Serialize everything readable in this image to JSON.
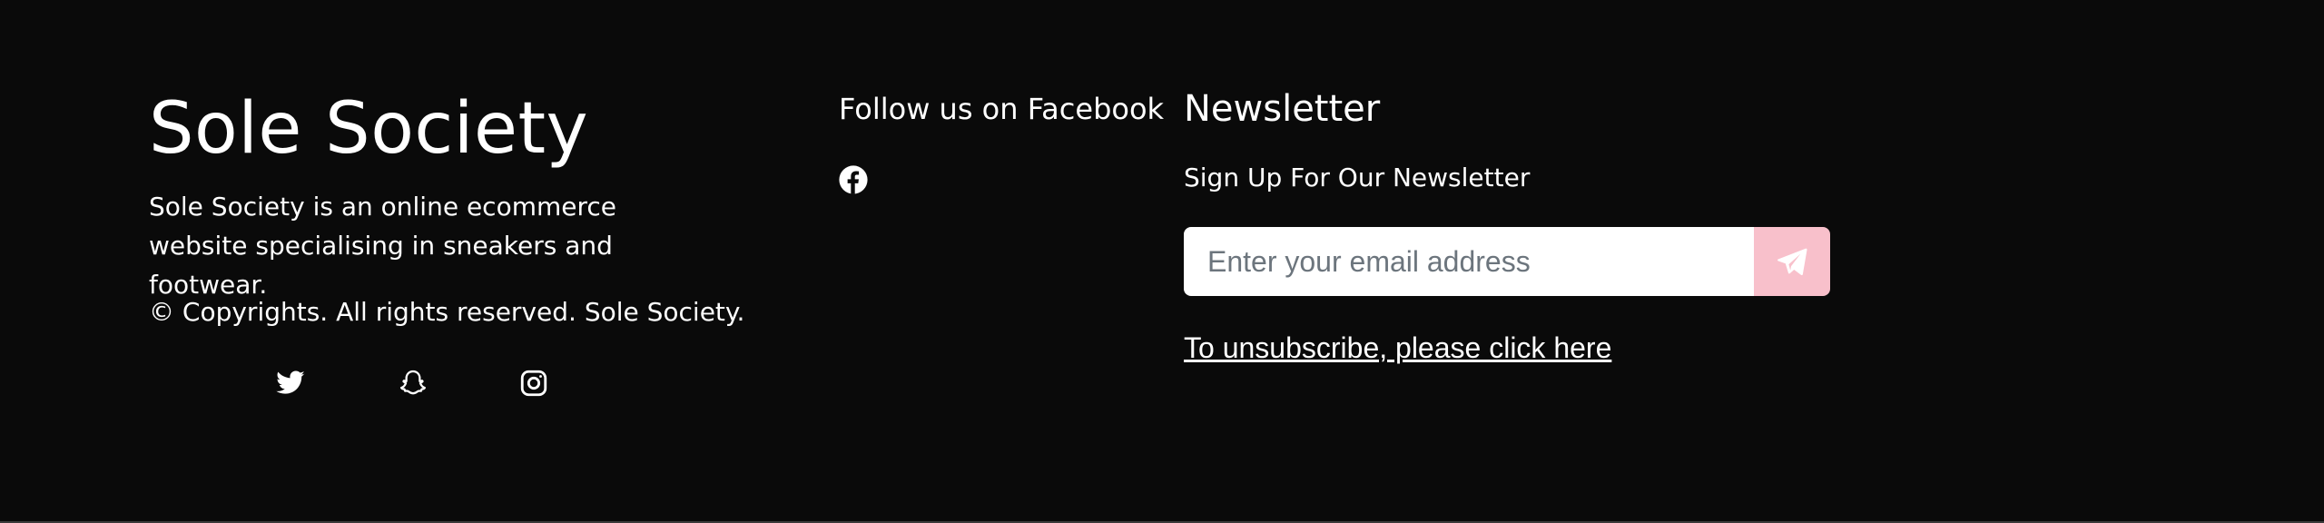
{
  "brand": {
    "title": "Sole Society",
    "description": "Sole Society is an online ecommerce website specialising in sneakers and footwear.",
    "copyright": "© Copyrights. All rights reserved. Sole Society."
  },
  "socials": [
    {
      "name": "twitter",
      "icon": "twitter-icon"
    },
    {
      "name": "snapchat",
      "icon": "snapchat-icon"
    },
    {
      "name": "instagram",
      "icon": "instagram-icon"
    }
  ],
  "facebook": {
    "heading": "Follow us on Facebook",
    "icon": "facebook-icon"
  },
  "newsletter": {
    "heading": "Newsletter",
    "subheading": "Sign Up For Our Newsletter",
    "email_placeholder": "Enter your email address",
    "email_value": "",
    "submit_icon": "paper-plane-icon",
    "unsubscribe_text": "To unsubscribe, please click here"
  },
  "colors": {
    "background": "#0a0a0a",
    "text": "#ffffff",
    "accent_button": "#f8c0cb"
  }
}
